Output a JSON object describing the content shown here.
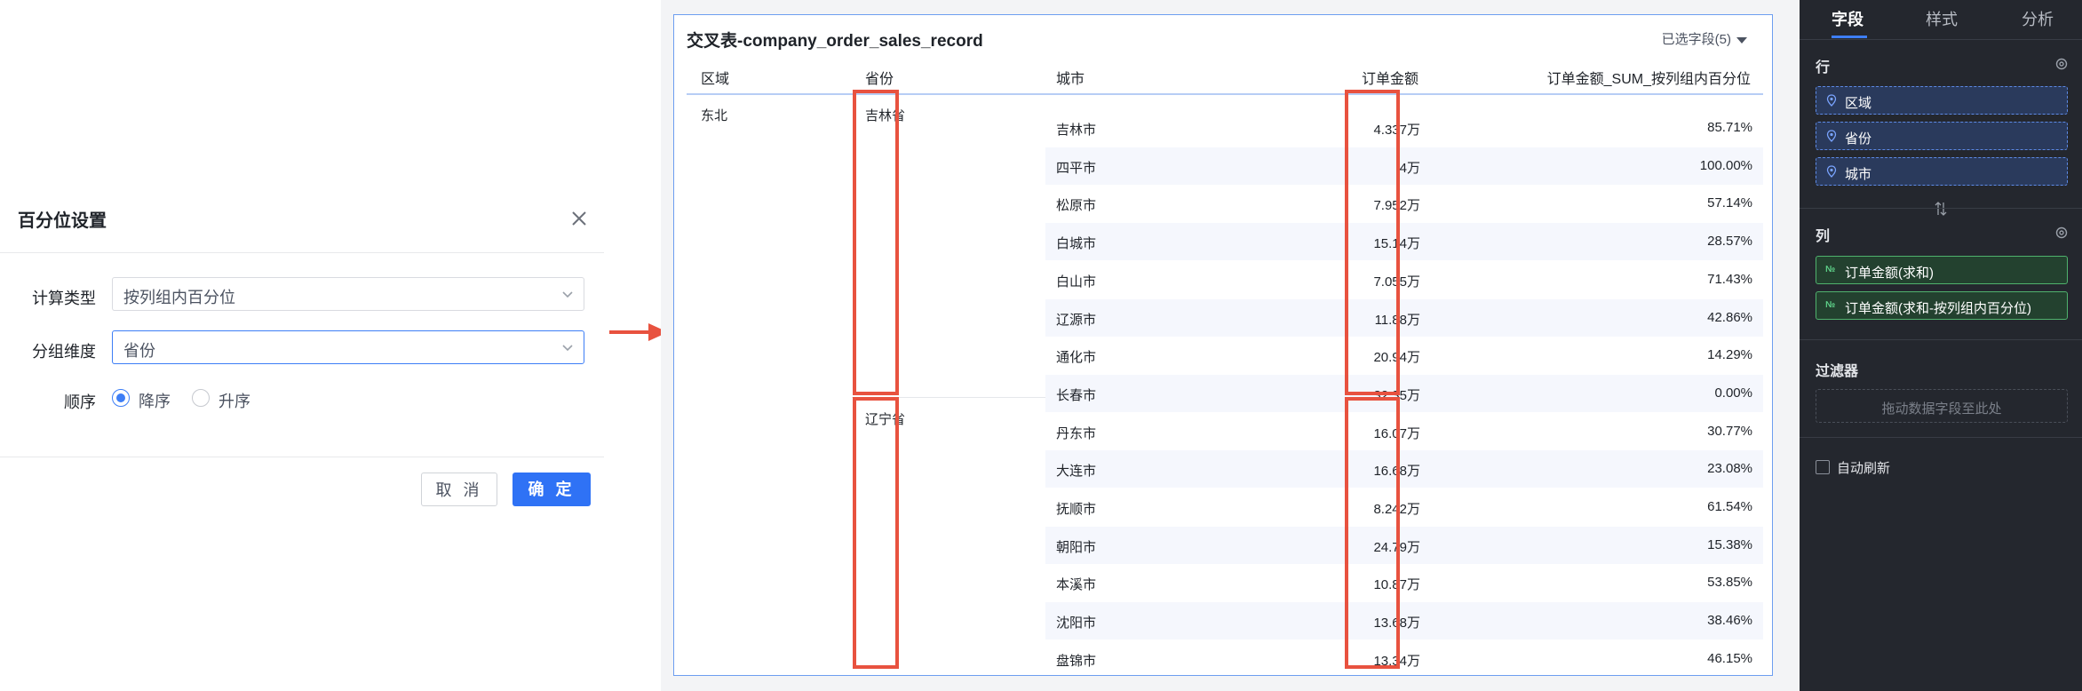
{
  "dialog": {
    "title": "百分位设置",
    "calc_type_label": "计算类型",
    "calc_type_value": "按列组内百分位",
    "group_dim_label": "分组维度",
    "group_dim_value": "省份",
    "order_label": "顺序",
    "order_desc": "降序",
    "order_asc": "升序",
    "order_selected": "降序",
    "cancel": "取 消",
    "ok": "确 定"
  },
  "table": {
    "title": "交叉表-company_order_sales_record",
    "fields_selected": "已选字段(5)",
    "headers": [
      "区域",
      "省份",
      "城市",
      "订单金额",
      "订单金额_SUM_按列组内百分位"
    ],
    "region": "东北",
    "groups": [
      {
        "province": "吉林省",
        "rows": [
          {
            "city": "吉林市",
            "amount": "4.337万",
            "pct": "85.71%"
          },
          {
            "city": "四平市",
            "amount": "4万",
            "pct": "100.00%"
          },
          {
            "city": "松原市",
            "amount": "7.952万",
            "pct": "57.14%"
          },
          {
            "city": "白城市",
            "amount": "15.14万",
            "pct": "28.57%"
          },
          {
            "city": "白山市",
            "amount": "7.055万",
            "pct": "71.43%"
          },
          {
            "city": "辽源市",
            "amount": "11.88万",
            "pct": "42.86%"
          },
          {
            "city": "通化市",
            "amount": "20.94万",
            "pct": "14.29%"
          },
          {
            "city": "长春市",
            "amount": "32.35万",
            "pct": "0.00%"
          }
        ]
      },
      {
        "province": "辽宁省",
        "rows": [
          {
            "city": "丹东市",
            "amount": "16.07万",
            "pct": "30.77%"
          },
          {
            "city": "大连市",
            "amount": "16.68万",
            "pct": "23.08%"
          },
          {
            "city": "抚顺市",
            "amount": "8.242万",
            "pct": "61.54%"
          },
          {
            "city": "朝阳市",
            "amount": "24.79万",
            "pct": "15.38%"
          },
          {
            "city": "本溪市",
            "amount": "10.87万",
            "pct": "53.85%"
          },
          {
            "city": "沈阳市",
            "amount": "13.68万",
            "pct": "38.46%"
          },
          {
            "city": "盘锦市",
            "amount": "13.34万",
            "pct": "46.15%"
          }
        ]
      }
    ]
  },
  "panel": {
    "tabs": [
      "字段",
      "样式",
      "分析"
    ],
    "active_tab": "字段",
    "rows_label": "行",
    "row_fields": [
      "区域",
      "省份",
      "城市"
    ],
    "cols_label": "列",
    "col_fields": [
      "订单金额(求和)",
      "订单金额(求和-按列组内百分位)"
    ],
    "measure_icon": "№",
    "filter_label": "过滤器",
    "filter_placeholder": "拖动数据字段至此处",
    "auto_refresh_label": "自动刷新"
  },
  "colors": {
    "accent": "#2f72f5",
    "highlight_box": "#e8523f",
    "panel_bg": "#24272e",
    "dimension_pill": "#5d8ae6",
    "measure_pill": "#4fb26d"
  }
}
